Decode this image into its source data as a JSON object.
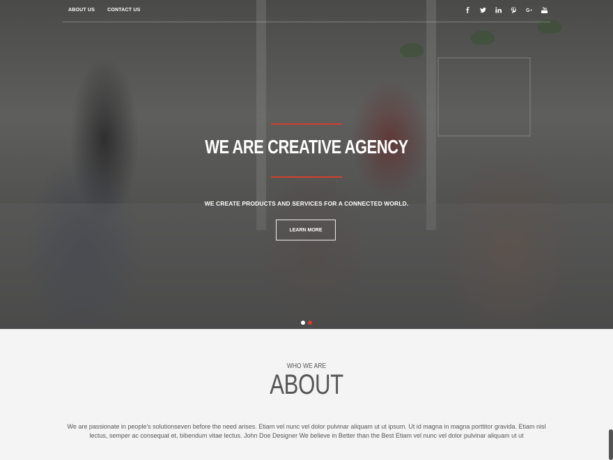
{
  "nav": {
    "links": [
      {
        "label": "ABOUT US"
      },
      {
        "label": "CONTACT US"
      }
    ],
    "social_icons": [
      "facebook-icon",
      "twitter-icon",
      "linkedin-icon",
      "pinterest-icon",
      "google-plus-icon",
      "youtube-icon"
    ]
  },
  "hero": {
    "title": "WE ARE CREATIVE AGENCY",
    "subtitle": "WE CREATE PRODUCTS AND SERVICES FOR A CONNECTED WORLD.",
    "button_label": "LEARN MORE",
    "slides": 2,
    "active_slide": 2,
    "accent_color": "#d2412f"
  },
  "about": {
    "kicker": "WHO WE ARE",
    "title": "ABOUT",
    "text": "We are passionate in people's solutionseven before the need arises. Etiam vel nunc vel dolor pulvinar aliquam ut ut ipsum. Ut id magna in magna porttitor gravida. Etiam nisl lectus, semper ac consequat et, bibendum vitae lectus. John Doe Designer We believe in Better than the Best Etiam vel nunc vel dolor pulvinar aliquam ut ut"
  }
}
